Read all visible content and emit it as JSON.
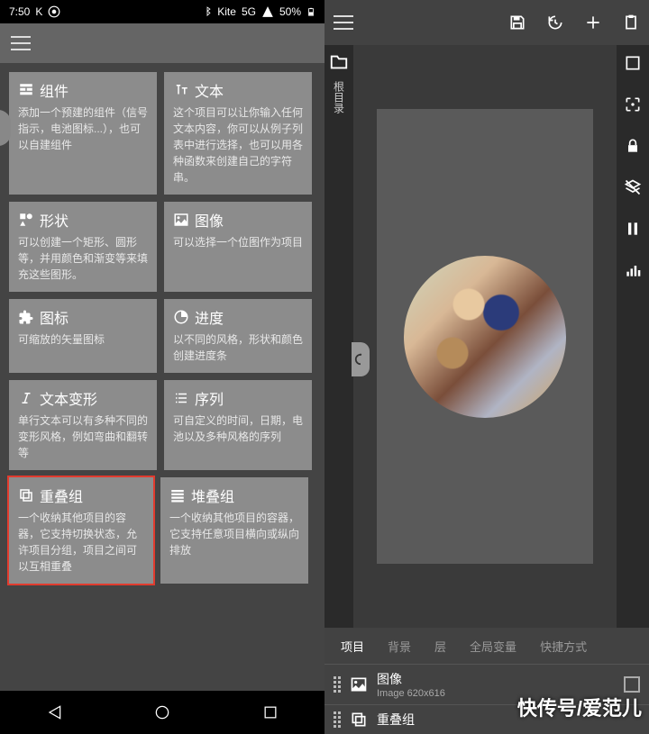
{
  "statusbar": {
    "time": "7:50",
    "letter": "K",
    "kite": "Kite",
    "network": "5G",
    "battery": "50%"
  },
  "cards": [
    {
      "title": "组件",
      "desc": "添加一个预建的组件（信号指示，电池图标...），也可以自建组件"
    },
    {
      "title": "文本",
      "desc": "这个项目可以让你输入任何文本内容，你可以从例子列表中进行选择，也可以用各种函数来创建自己的字符串。"
    },
    {
      "title": "形状",
      "desc": "可以创建一个矩形、圆形等，并用颜色和渐变等来填充这些图形。"
    },
    {
      "title": "图像",
      "desc": "可以选择一个位图作为项目"
    },
    {
      "title": "图标",
      "desc": "可缩放的矢量图标"
    },
    {
      "title": "进度",
      "desc": "以不同的风格，形状和颜色创建进度条"
    },
    {
      "title": "文本变形",
      "desc": "单行文本可以有多种不同的变形风格，例如弯曲和翻转等"
    },
    {
      "title": "序列",
      "desc": "可自定义的时间，日期，电池以及多种风格的序列"
    },
    {
      "title": "重叠组",
      "desc": "一个收纳其他项目的容器，它支持切换状态，允许项目分组，项目之间可以互相重叠"
    },
    {
      "title": "堆叠组",
      "desc": "一个收纳其他项目的容器，它支持任意项目横向或纵向排放"
    }
  ],
  "right": {
    "sidelabel": "根目录",
    "tabs": [
      "项目",
      "背景",
      "层",
      "全局变量",
      "快捷方式"
    ],
    "layers": [
      {
        "name": "图像",
        "sub": "Image 620x616"
      },
      {
        "name": "重叠组",
        "sub": ""
      }
    ]
  },
  "watermark": "快传号/爱范儿"
}
